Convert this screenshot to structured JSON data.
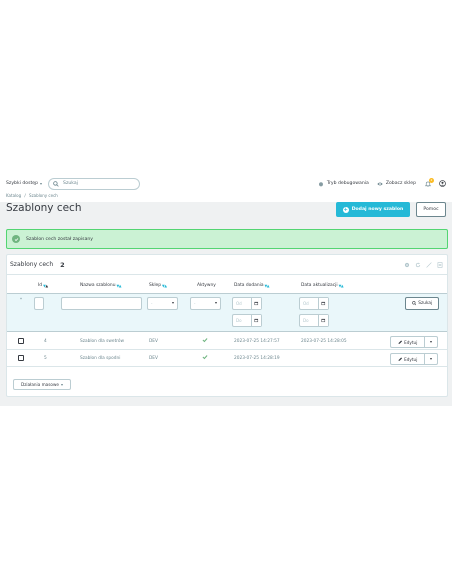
{
  "topbar": {
    "quick_access": "Szybki dostęp",
    "search_placeholder": "Szukaj",
    "debug_mode": "Tryb debugowania",
    "view_shop": "Zobacz sklep",
    "notification_count": "2"
  },
  "breadcrumb": {
    "parent": "Katalog",
    "sep": "/",
    "current": "Szablony cech"
  },
  "page": {
    "title": "Szablony cech",
    "add_button": "Dodaj nowy szablon",
    "help_button": "Pomoc"
  },
  "alert": {
    "message": "Szablon cech został zapisany"
  },
  "panel": {
    "title": "Szablony cech",
    "count": "2"
  },
  "columns": {
    "id": "Id",
    "name": "Nazwa szablonu",
    "shop": "Sklep",
    "active": "Aktywny",
    "date_add": "Data dodania",
    "date_upd": "Data aktualizacji"
  },
  "filters": {
    "select_dash": "-",
    "from": "Od",
    "to": "Do",
    "search_button": "Szukaj"
  },
  "rows": [
    {
      "id": "4",
      "name": "Szablon dla swetrów",
      "shop": "DEV",
      "date_add": "2023-07-25 14:27:57",
      "date_upd": "2023-07-25 14:28:05",
      "action": "Edytuj"
    },
    {
      "id": "5",
      "name": "Szablon dla spodni",
      "shop": "DEV",
      "date_add": "2023-07-25 14:28:19",
      "date_upd": "",
      "action": "Edytuj"
    }
  ],
  "bulk": {
    "label": "Działania masowe"
  },
  "colors": {
    "accent": "#25b9d7",
    "success": "#70b580",
    "alert_bg": "#cbf2d4",
    "filter_bg": "#eaf7fa"
  },
  "icons": [
    "search-icon",
    "bug-icon",
    "eye-icon",
    "bell-icon",
    "user-icon",
    "plus-icon",
    "check-circle-icon",
    "calendar-icon",
    "pencil-icon",
    "refresh-icon",
    "settings-icon"
  ]
}
